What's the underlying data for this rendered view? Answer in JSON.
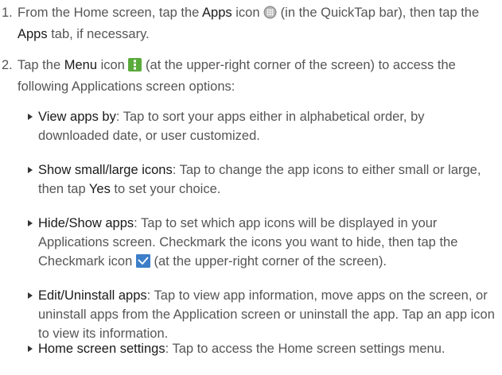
{
  "steps": [
    {
      "number": "1.",
      "t1": "From the Home screen, tap the ",
      "b1": "Apps",
      "t2": " icon ",
      "t3": " (in the QuickTap bar), then tap the ",
      "b2": "Apps",
      "t4": " tab, if necessary."
    },
    {
      "number": "2.",
      "t1": "Tap the ",
      "b1": "Menu",
      "t2": " icon ",
      "t3": " (at the upper-right corner of the screen) to access the following Applications screen options:"
    }
  ],
  "options": [
    {
      "term": "View apps by",
      "text": ": Tap to sort your apps either in alphabetical order, by downloaded date, or user customized."
    },
    {
      "term": "Show small/large icons",
      "text": ": Tap to change the app icons to either small or large, then tap ",
      "b": "Yes",
      "text2": " to set your choice."
    },
    {
      "term": "Hide/Show apps",
      "text": ": Tap to set which app icons will be displayed in your Applications screen. Checkmark the icons you want to hide, then tap the Checkmark icon ",
      "text2": " (at the upper-right corner of the screen)."
    },
    {
      "term": "Edit/Uninstall apps",
      "text": ": Tap to view app information, move apps on the screen, or uninstall apps from the Application screen or uninstall the app. Tap an app icon to view its information."
    },
    {
      "term": "Home screen settings",
      "text": ": Tap to access the Home screen settings menu."
    }
  ],
  "icons": {
    "apps": "apps-grid-icon",
    "menu": "menu-vertical-dots-icon",
    "checkmark": "checkmark-icon"
  },
  "colors": {
    "body_text": "#555555",
    "bold_text": "#1a1a1a",
    "menu_icon_bg": "#5aab3c",
    "checkmark_icon_bg": "#3d7ec8"
  }
}
